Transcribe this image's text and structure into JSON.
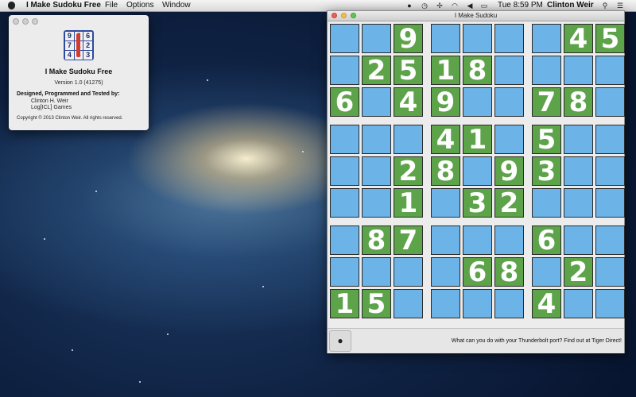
{
  "menubar": {
    "app_name": "I Make Sudoku Free",
    "menus": [
      "File",
      "Options",
      "Window"
    ],
    "clock": "Tue 8:59 PM",
    "user": "Clinton Weir"
  },
  "about": {
    "app_name": "I Make Sudoku Free",
    "version": "Version 1.0 (41275)",
    "credits_heading": "Designed, Programmed and Tested by:",
    "author": "Clinton H. Weir",
    "company": "Log[ICL] Games",
    "copyright": "Copyright © 2013 Clinton Weir. All rights reserved.",
    "icon_digits": [
      "9",
      "8",
      "6",
      "7",
      "1",
      "2",
      "4",
      "5",
      "3"
    ]
  },
  "sudoku": {
    "title": "I Make Sudoku",
    "grid": [
      [
        "",
        "",
        "9",
        "",
        "",
        "",
        "",
        "4",
        "5"
      ],
      [
        "",
        "2",
        "5",
        "1",
        "8",
        "",
        "",
        "",
        ""
      ],
      [
        "6",
        "",
        "4",
        "9",
        "",
        "",
        "7",
        "8",
        ""
      ],
      [
        "",
        "",
        "",
        "4",
        "1",
        "",
        "5",
        "",
        ""
      ],
      [
        "",
        "",
        "2",
        "8",
        "",
        "9",
        "3",
        "",
        ""
      ],
      [
        "",
        "",
        "1",
        "",
        "3",
        "2",
        "",
        "",
        ""
      ],
      [
        "",
        "8",
        "7",
        "",
        "",
        "",
        "6",
        "",
        ""
      ],
      [
        "",
        "",
        "",
        "",
        "6",
        "8",
        "",
        "2",
        ""
      ],
      [
        "1",
        "5",
        "",
        "",
        "",
        "",
        "4",
        "",
        ""
      ]
    ],
    "ad_text": "What can you do with your Thunderbolt port? Find out at Tiger Direct!"
  },
  "colors": {
    "given_cell": "#5da34a",
    "empty_cell": "#6cb4e8"
  }
}
